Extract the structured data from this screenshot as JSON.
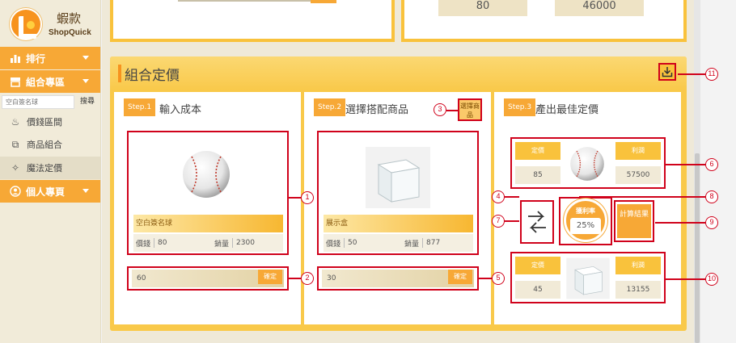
{
  "brand": {
    "name_cn": "蝦款",
    "name_en": "ShopQuick"
  },
  "sidebar": {
    "nav": [
      {
        "label": "排行"
      },
      {
        "label": "組合專區"
      }
    ],
    "search": {
      "placeholder": "空白簽名球",
      "button": "搜尋"
    },
    "items": [
      {
        "label": "價錢區間"
      },
      {
        "label": "商品組合"
      },
      {
        "label": "魔法定價"
      }
    ],
    "personal": {
      "label": "個人專頁"
    }
  },
  "top_values": {
    "left": "80",
    "right": "46000"
  },
  "panel": {
    "title": "組合定價",
    "steps": [
      {
        "badge": "Step.1",
        "title": "輸入成本"
      },
      {
        "badge": "Step.2",
        "title": "選擇搭配商品"
      },
      {
        "badge": "Step.3",
        "title": "產出最佳定價"
      }
    ],
    "select_button": "選擇商品",
    "product1": {
      "name": "空白簽名球",
      "price_label": "價錢",
      "price": "80",
      "sales_label": "銷量",
      "sales": "2300"
    },
    "product2": {
      "name": "展示盒",
      "price_label": "價錢",
      "price": "50",
      "sales_label": "銷量",
      "sales": "877"
    },
    "cost1": {
      "value": "60",
      "confirm": "確定"
    },
    "cost2": {
      "value": "30",
      "confirm": "確定"
    },
    "result1": {
      "price_label": "定價",
      "price": "85",
      "profit_label": "利潤",
      "profit": "57500"
    },
    "result2": {
      "price_label": "定價",
      "price": "45",
      "profit_label": "利潤",
      "profit": "13155"
    },
    "margin": {
      "label": "獲利率",
      "value": "25%"
    },
    "calc_button": "計算結果"
  },
  "callouts": [
    "1",
    "2",
    "3",
    "4",
    "5",
    "6",
    "7",
    "8",
    "9",
    "10",
    "11"
  ],
  "colors": {
    "accent": "#f7a836",
    "panel": "#f9c94a",
    "callout": "#d0021b"
  }
}
